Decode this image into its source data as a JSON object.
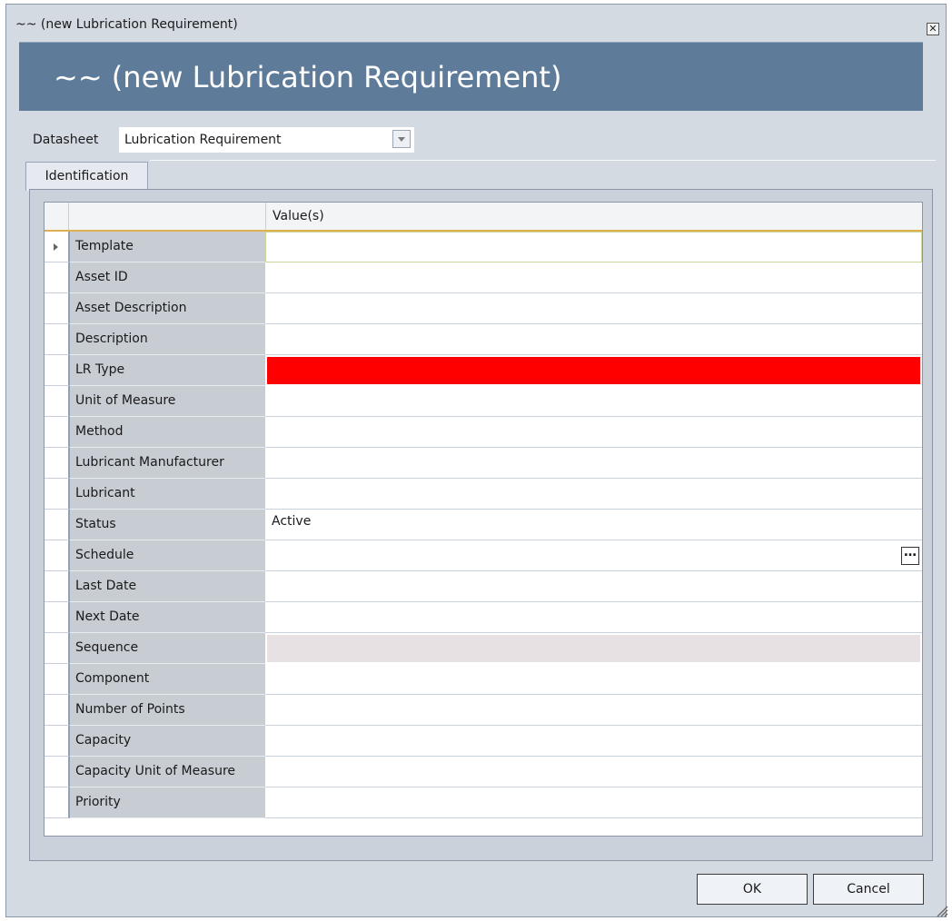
{
  "window": {
    "title": "~~ (new Lubrication Requirement)"
  },
  "banner": {
    "title": "~~ (new Lubrication Requirement)"
  },
  "datasheet": {
    "label": "Datasheet",
    "value": "Lubrication Requirement"
  },
  "tabs": [
    {
      "label": "Identification"
    }
  ],
  "grid": {
    "value_header": "Value(s)",
    "rows": [
      {
        "label": "Template",
        "value": ""
      },
      {
        "label": "Asset ID",
        "value": ""
      },
      {
        "label": "Asset Description",
        "value": ""
      },
      {
        "label": "Description",
        "value": ""
      },
      {
        "label": "LR Type",
        "value": ""
      },
      {
        "label": "Unit of Measure",
        "value": ""
      },
      {
        "label": "Method",
        "value": ""
      },
      {
        "label": "Lubricant Manufacturer",
        "value": ""
      },
      {
        "label": "Lubricant",
        "value": ""
      },
      {
        "label": "Status",
        "value": "Active"
      },
      {
        "label": "Schedule",
        "value": ""
      },
      {
        "label": "Last Date",
        "value": ""
      },
      {
        "label": "Next Date",
        "value": ""
      },
      {
        "label": "Sequence",
        "value": ""
      },
      {
        "label": "Component",
        "value": ""
      },
      {
        "label": "Number of Points",
        "value": ""
      },
      {
        "label": "Capacity",
        "value": ""
      },
      {
        "label": "Capacity Unit of Measure",
        "value": ""
      },
      {
        "label": "Priority",
        "value": ""
      }
    ]
  },
  "buttons": {
    "ok": "OK",
    "cancel": "Cancel"
  },
  "colors": {
    "banner": "#5f7b9a",
    "required_field": "#ff0000",
    "disabled_field": "#e7e1e3"
  }
}
